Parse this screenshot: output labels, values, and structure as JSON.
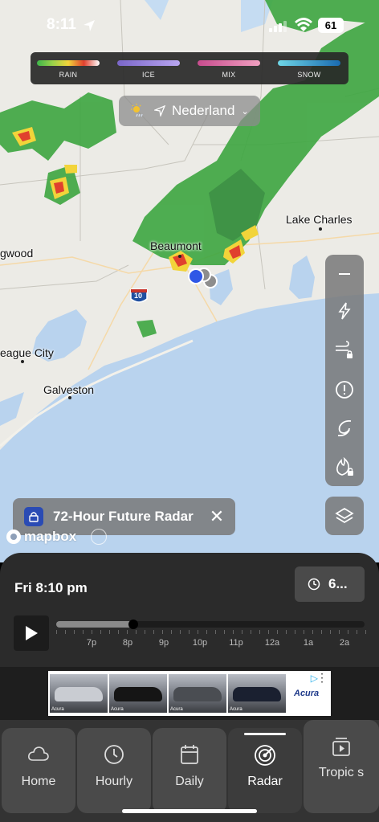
{
  "status": {
    "time": "8:11",
    "battery": "61"
  },
  "legend": [
    {
      "label": "RAIN",
      "gradient": "linear-gradient(90deg,#3db54a,#9ad24a,#f2d43a,#e0402e,#fff)"
    },
    {
      "label": "ICE",
      "gradient": "linear-gradient(90deg,#7a66c8,#b9a6f0)"
    },
    {
      "label": "MIX",
      "gradient": "linear-gradient(90deg,#c84c8e,#f0a0c0)"
    },
    {
      "label": "SNOW",
      "gradient": "linear-gradient(90deg,#6fd6e6,#1a6bb0)"
    }
  ],
  "location": {
    "name": "Nederland"
  },
  "map": {
    "cities": [
      "Beaumont",
      "Lake Charles",
      "gwood",
      "eague City",
      "Galveston"
    ],
    "highway": "10",
    "attribution": "mapbox"
  },
  "future_radar": {
    "label": "72-Hour Future Radar"
  },
  "panel": {
    "datetime": "Fri 8:10 pm",
    "speed_label": "6...",
    "timeline_labels": [
      "7p",
      "8p",
      "9p",
      "10p",
      "11p",
      "12a",
      "1a",
      "2a"
    ],
    "progress": 0.25
  },
  "ad": {
    "dealer": "Acura",
    "brand_label": "Acura"
  },
  "tabs": [
    {
      "label": "Home",
      "icon": "cloud-icon"
    },
    {
      "label": "Hourly",
      "icon": "clock-icon"
    },
    {
      "label": "Daily",
      "icon": "calendar-icon"
    },
    {
      "label": "Radar",
      "icon": "radar-icon",
      "active": true
    },
    {
      "label": "Tropic s",
      "icon": "video-icon"
    }
  ],
  "colors": {
    "accent_lock": "#2a4bb4",
    "panel": "#2b2b2b",
    "water": "#b9d3ee"
  }
}
